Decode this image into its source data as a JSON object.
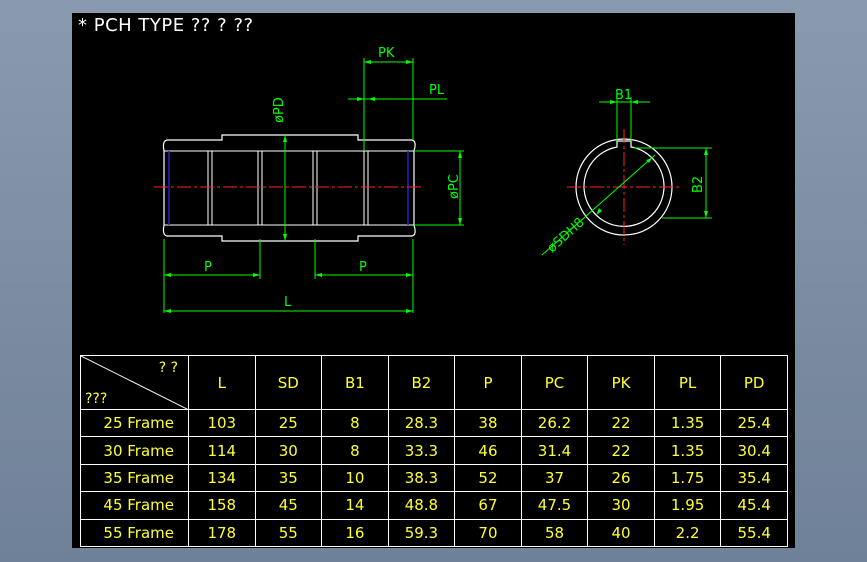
{
  "title": "* PCH TYPE ?? ? ??",
  "dimensions": {
    "pk": "PK",
    "pl": "PL",
    "pd": "øPD",
    "pc": "øPC",
    "p_left": "P",
    "p_right": "P",
    "l": "L",
    "b1": "B1",
    "b2": "B2",
    "sd": "øSDH8"
  },
  "colors": {
    "background": "#000000",
    "outline": "#ffffff",
    "dimension": "#00ff00",
    "centerline": "#ff0000",
    "table_text": "#ffff33",
    "edge_blue": "#0000cc"
  },
  "table": {
    "corner_top": "? ?",
    "corner_bottom": "???",
    "headers": [
      "L",
      "SD",
      "B1",
      "B2",
      "P",
      "PC",
      "PK",
      "PL",
      "PD"
    ],
    "rows": [
      {
        "frame": "25 Frame",
        "values": [
          "103",
          "25",
          "8",
          "28.3",
          "38",
          "26.2",
          "22",
          "1.35",
          "25.4"
        ]
      },
      {
        "frame": "30 Frame",
        "values": [
          "114",
          "30",
          "8",
          "33.3",
          "46",
          "31.4",
          "22",
          "1.35",
          "30.4"
        ]
      },
      {
        "frame": "35 Frame",
        "values": [
          "134",
          "35",
          "10",
          "38.3",
          "52",
          "37",
          "26",
          "1.75",
          "35.4"
        ]
      },
      {
        "frame": "45 Frame",
        "values": [
          "158",
          "45",
          "14",
          "48.8",
          "67",
          "47.5",
          "30",
          "1.95",
          "45.4"
        ]
      },
      {
        "frame": "55 Frame",
        "values": [
          "178",
          "55",
          "16",
          "59.3",
          "70",
          "58",
          "40",
          "2.2",
          "55.4"
        ]
      }
    ]
  }
}
